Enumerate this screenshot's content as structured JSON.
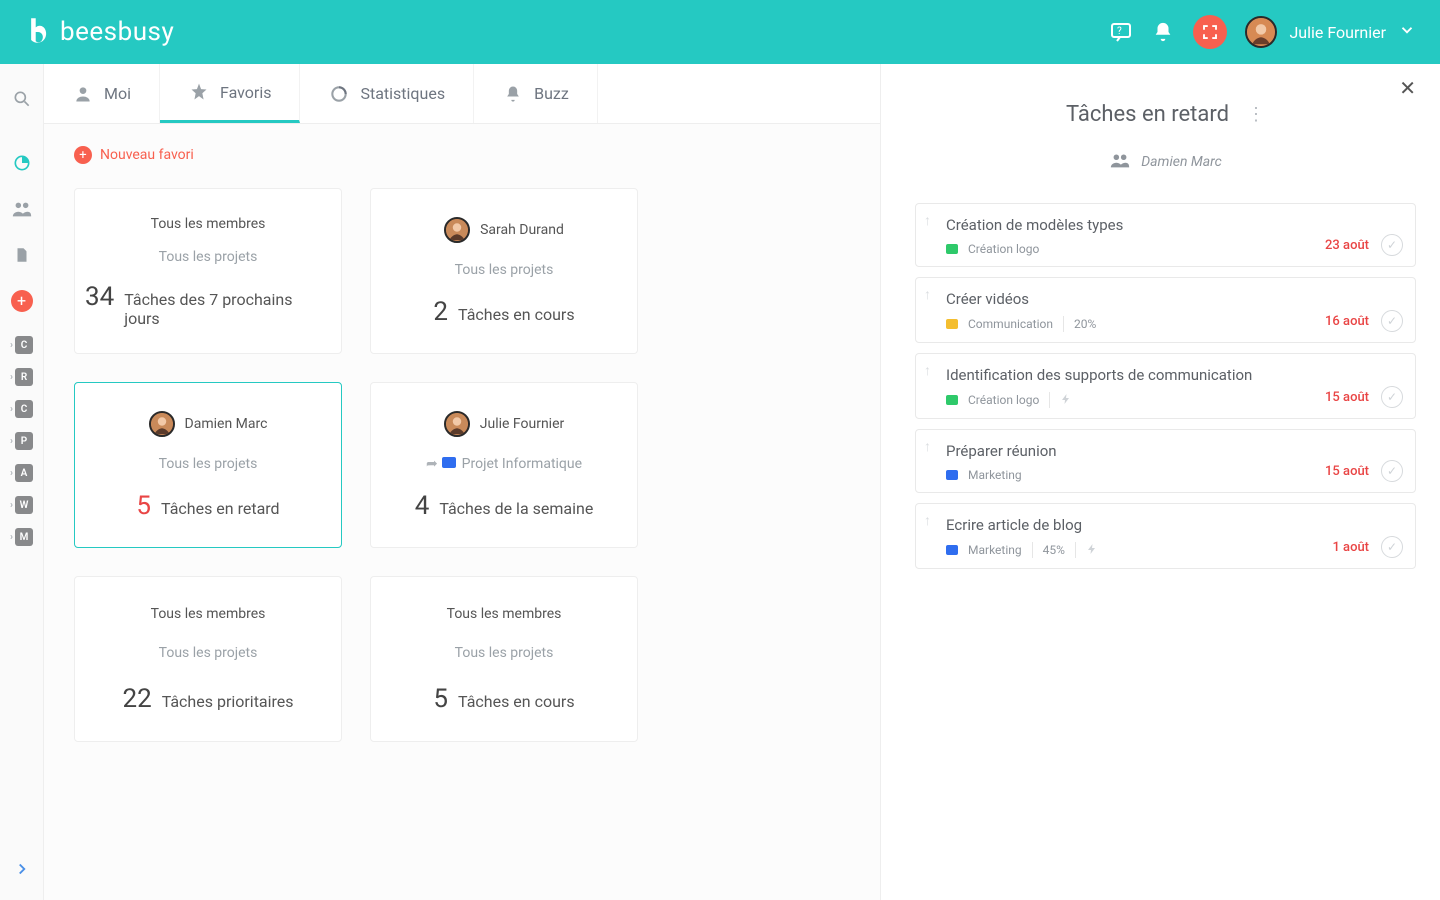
{
  "brand": {
    "name": "beesbusy"
  },
  "user": {
    "name": "Julie Fournier"
  },
  "tabs": [
    {
      "label": "Moi"
    },
    {
      "label": "Favoris"
    },
    {
      "label": "Statistiques"
    },
    {
      "label": "Buzz"
    }
  ],
  "newfav": {
    "label": "Nouveau favori"
  },
  "sidebar_projects": [
    "C",
    "R",
    "C",
    "P",
    "A",
    "W",
    "M"
  ],
  "cards": [
    {
      "row1": "Tous les membres",
      "row2": "Tous les projets",
      "count": "34",
      "label": "Tâches des 7 prochains jours"
    },
    {
      "row1": "Sarah Durand",
      "row2": "Tous les projets",
      "count": "2",
      "label": "Tâches en cours",
      "avatar": "SD"
    },
    {
      "row1": "Damien Marc",
      "row2": "Tous les projets",
      "count": "5",
      "label": "Tâches en retard",
      "avatar": "DM",
      "selected": true
    },
    {
      "row1": "Julie Fournier",
      "row2": "Projet Informatique",
      "count": "4",
      "label": "Tâches de la semaine",
      "avatar": "JF",
      "proj": true
    },
    {
      "row1": "Tous les membres",
      "row2": "Tous les projets",
      "count": "22",
      "label": "Tâches prioritaires"
    },
    {
      "row1": "Tous les membres",
      "row2": "Tous les projets",
      "count": "5",
      "label": "Tâches en cours"
    }
  ],
  "panel": {
    "title": "Tâches en retard",
    "subtitle": "Damien Marc",
    "tasks": [
      {
        "title": "Création de modèles types",
        "project": "Création logo",
        "color": "green",
        "date": "23 août"
      },
      {
        "title": "Créer vidéos",
        "project": "Communication",
        "color": "yellow",
        "pct": "20%",
        "date": "16 août"
      },
      {
        "title": "Identification des supports de communication",
        "project": "Création logo",
        "color": "green",
        "bolt": true,
        "date": "15 août"
      },
      {
        "title": "Préparer réunion",
        "project": "Marketing",
        "color": "blue",
        "date": "15 août"
      },
      {
        "title": "Ecrire article de blog",
        "project": "Marketing",
        "color": "blue",
        "pct": "45%",
        "bolt": true,
        "date": "1 août"
      }
    ]
  }
}
